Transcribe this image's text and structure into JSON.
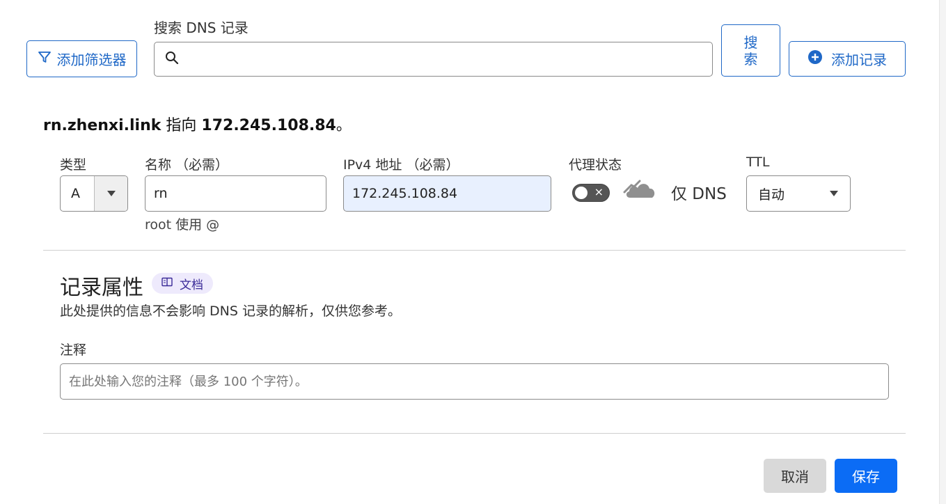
{
  "toolbar": {
    "filter_label": "添加筛选器",
    "search_label": "搜索 DNS 记录",
    "search_value": "",
    "search_button": "搜\n索",
    "search_button_top": "搜",
    "search_button_bottom": "索",
    "add_record": "添加记录"
  },
  "headline": {
    "name": "rn.zhenxi.link",
    "mid": " 指向 ",
    "ip": "172.245.108.84",
    "end": "。"
  },
  "form": {
    "type_label": "类型",
    "type_value": "A",
    "name_label": "名称 （必需）",
    "name_value": "rn",
    "name_hint": "root 使用 @",
    "ipv4_label": "IPv4 地址 （必需）",
    "ipv4_value": "172.245.108.84",
    "proxy_label": "代理状态",
    "proxy_text": "仅 DNS",
    "ttl_label": "TTL",
    "ttl_value": "自动"
  },
  "attributes": {
    "title": "记录属性",
    "doc_badge": "文档",
    "desc": "此处提供的信息不会影响 DNS 记录的解析，仅供您参考。",
    "comment_label": "注释",
    "comment_placeholder": "在此处输入您的注释（最多 100 个字符）。"
  },
  "actions": {
    "cancel": "取消",
    "save": "保存"
  },
  "colors": {
    "accent": "#1f68c7",
    "save_bg": "#0b6cf5",
    "ip_field_bg": "#e8f0fe"
  }
}
